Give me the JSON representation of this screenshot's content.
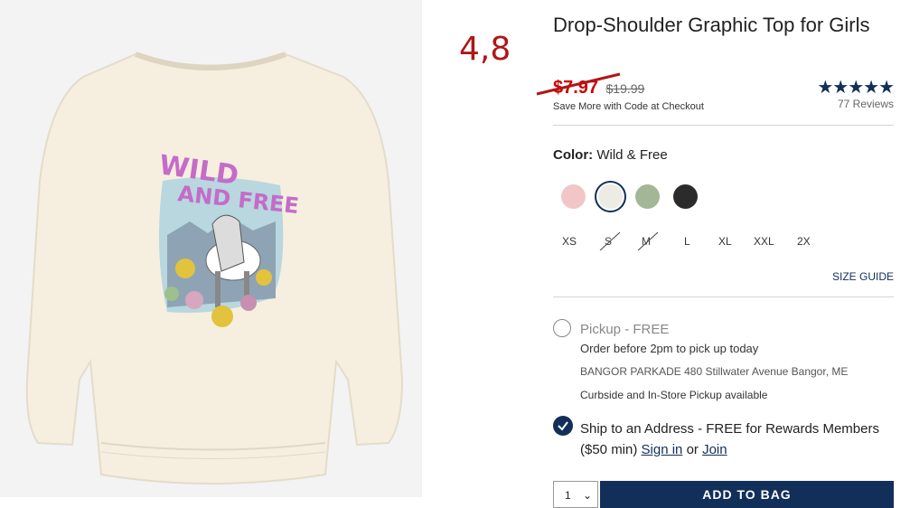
{
  "annotation": {
    "rating": "4,8"
  },
  "product": {
    "title": "Drop-Shoulder Graphic Top for Girls",
    "sale_price": "$7.97",
    "original_price": "$19.99",
    "save_note": "Save More with Code at Checkout",
    "reviews": {
      "stars": "★★★★★",
      "count_text": "77 Reviews"
    },
    "graphic": {
      "text_line1": "WILD",
      "text_line2": "AND FREE"
    }
  },
  "color": {
    "label": "Color:",
    "value": "Wild & Free",
    "swatches": [
      {
        "name": "pink",
        "hex": "#f2c6c6",
        "selected": false
      },
      {
        "name": "cream",
        "hex": "#ecebe4",
        "selected": true
      },
      {
        "name": "sage",
        "hex": "#a3b796",
        "selected": false
      },
      {
        "name": "black",
        "hex": "#2b2b2b",
        "selected": false
      }
    ]
  },
  "sizes": [
    {
      "label": "XS",
      "available": true
    },
    {
      "label": "S",
      "available": false
    },
    {
      "label": "M",
      "available": false
    },
    {
      "label": "L",
      "available": true
    },
    {
      "label": "XL",
      "available": true
    },
    {
      "label": "XXL",
      "available": true
    },
    {
      "label": "2X",
      "available": true
    }
  ],
  "size_guide": "SIZE GUIDE",
  "fulfillment": {
    "pickup_title": "Pickup - FREE",
    "pickup_sub": "Order before 2pm to pick up today",
    "store": "BANGOR PARKADE 480 Stillwater Avenue  Bangor, ME",
    "curbside": "Curbside and In-Store Pickup available",
    "ship_text": "Ship to an Address - FREE for Rewards Members ($50 min)",
    "sign_in": "Sign in",
    "or": "or",
    "join": "Join"
  },
  "cart": {
    "qty": "1",
    "add_to_bag": "ADD TO BAG"
  },
  "colors": {
    "brand_navy": "#122f5a",
    "sale_red": "#cc0000"
  }
}
